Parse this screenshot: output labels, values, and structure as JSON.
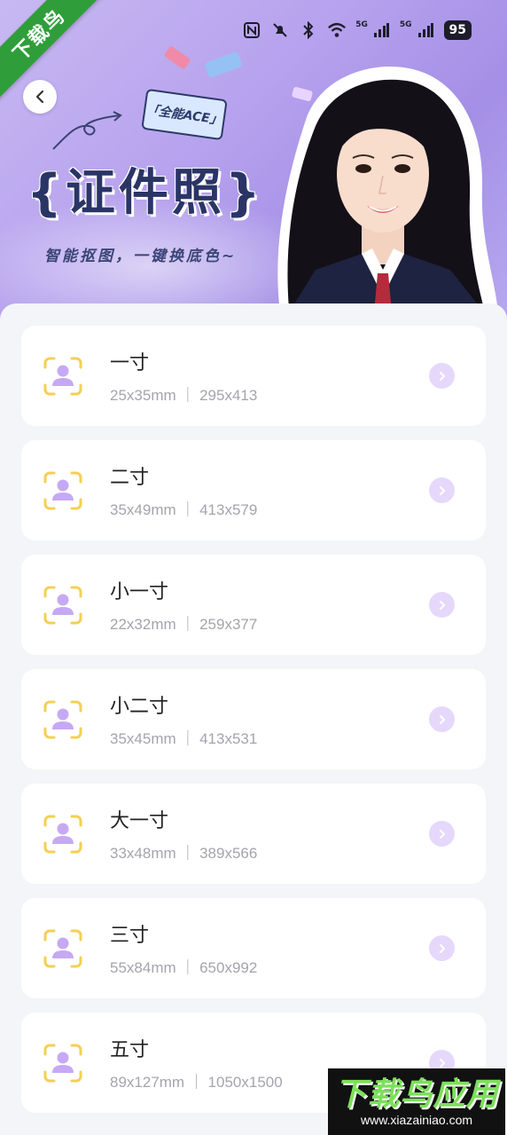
{
  "status_bar": {
    "battery": "95",
    "network_1": "5G",
    "network_2": "5G",
    "icons": [
      "nfc-icon",
      "mute-icon",
      "bluetooth-icon",
      "wifi-icon",
      "signal-icon",
      "signal-icon"
    ]
  },
  "corner_ribbon": {
    "text": "下载鸟"
  },
  "banner": {
    "tag": "「全能ACE」",
    "title": "{证件照}",
    "subtitle": "智能抠图，一键换底色~"
  },
  "sizes": [
    {
      "name": "一寸",
      "dims": "25x35mm ｜ 295x413"
    },
    {
      "name": "二寸",
      "dims": "35x49mm ｜ 413x579"
    },
    {
      "name": "小一寸",
      "dims": "22x32mm ｜ 259x377"
    },
    {
      "name": "小二寸",
      "dims": "35x45mm ｜ 413x531"
    },
    {
      "name": "大一寸",
      "dims": "33x48mm ｜ 389x566"
    },
    {
      "name": "三寸",
      "dims": "55x84mm ｜ 650x992"
    },
    {
      "name": "五寸",
      "dims": "89x127mm ｜ 1050x1500"
    }
  ],
  "watermark": {
    "main": "下载鸟应用",
    "url": "www.xiazainiao.com"
  },
  "colors": {
    "accent": "#e6d8fb",
    "icon_yellow": "#f5cf52",
    "icon_purple": "#c6a9f4",
    "title_navy": "#2a3566"
  }
}
